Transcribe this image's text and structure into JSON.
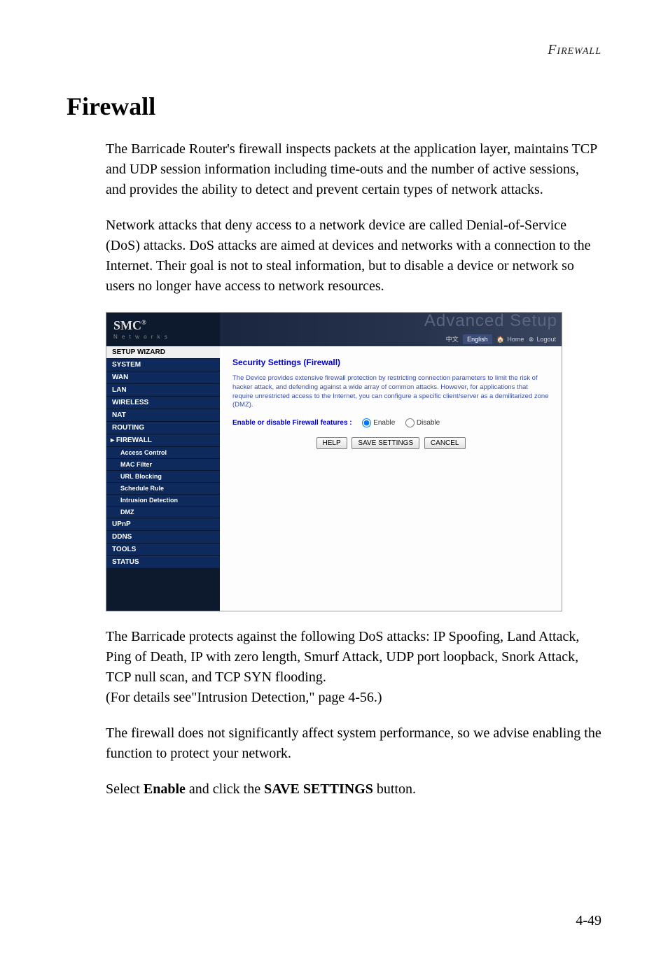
{
  "header": {
    "running_head": "Firewall"
  },
  "title": "Firewall",
  "paragraphs": {
    "p1": "The Barricade Router's firewall inspects packets at the application layer, maintains TCP and UDP session information including time-outs and the number of active sessions, and provides the ability to detect and prevent certain types of network attacks.",
    "p2": "Network attacks that deny access to a network device are called Denial-of-Service (DoS) attacks. DoS attacks are aimed at devices and networks with a connection to the Internet. Their goal is not to steal information, but to disable a device or network so users no longer have access to network resources.",
    "p3": "The Barricade protects against the following DoS attacks: IP Spoofing, Land Attack, Ping of Death, IP with zero length, Smurf Attack, UDP port loopback, Snork Attack, TCP null scan, and TCP SYN flooding.",
    "p3_note": "(For details see\"Intrusion Detection,\" page 4-56.)",
    "p4": "The firewall does not significantly affect system performance, so we advise enabling the function to protect your network.",
    "p5_pre": "Select ",
    "p5_bold1": "Enable",
    "p5_mid": " and click the ",
    "p5_bold2": "SAVE SETTINGS",
    "p5_post": " button."
  },
  "screenshot": {
    "logo_brand": "SMC",
    "logo_reg": "®",
    "logo_sub": "N e t w o r k s",
    "banner_text": "Advanced Setup",
    "lang_cn": "中文",
    "lang_en": "English",
    "home_icon": "🏠",
    "home": "Home",
    "logout_icon": "⊗",
    "logout": "Logout",
    "nav": {
      "wizard": "SETUP WIZARD",
      "system": "SYSTEM",
      "wan": "WAN",
      "lan": "LAN",
      "wireless": "WIRELESS",
      "nat": "NAT",
      "routing": "ROUTING",
      "firewall": "FIREWALL",
      "sub": {
        "access": "Access Control",
        "mac": "MAC Filter",
        "url": "URL Blocking",
        "schedule": "Schedule Rule",
        "intrusion": "Intrusion Detection",
        "dmz": "DMZ"
      },
      "upnp": "UPnP",
      "ddns": "DDNS",
      "tools": "TOOLS",
      "status": "STATUS"
    },
    "content": {
      "title": "Security Settings (Firewall)",
      "desc": "The Device provides extensive firewall protection by restricting connection parameters to limit the risk of hacker attack, and defending against a wide array of common attacks. However, for applications that require unrestricted access to the Internet, you can configure a specific client/server as a demilitarized zone (DMZ).",
      "enable_label": "Enable or disable Firewall features :",
      "opt_enable": "Enable",
      "opt_disable": "Disable",
      "btn_help": "HELP",
      "btn_save": "SAVE SETTINGS",
      "btn_cancel": "CANCEL"
    }
  },
  "page_number": "4-49"
}
